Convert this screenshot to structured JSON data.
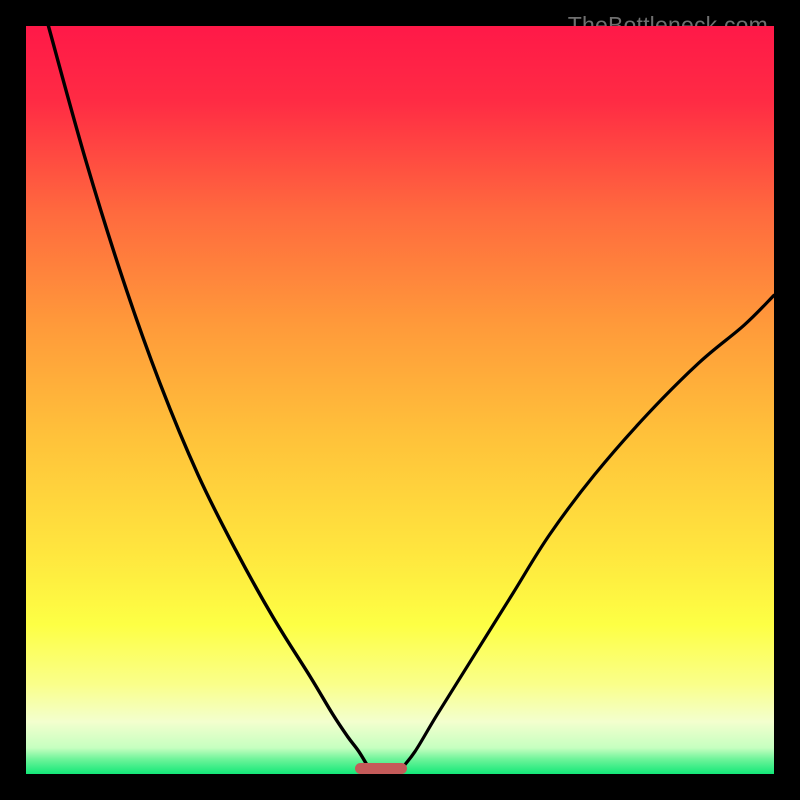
{
  "watermark": "TheBottleneck.com",
  "chart_data": {
    "type": "line",
    "title": "",
    "xlabel": "",
    "ylabel": "",
    "xlim": [
      0,
      100
    ],
    "ylim": [
      0,
      100
    ],
    "grid": false,
    "legend": false,
    "axes_visible": false,
    "background_gradient": [
      "#ff1948",
      "#ff8a3a",
      "#ffd63b",
      "#fcff46",
      "#f6ffcc",
      "#15e87a"
    ],
    "series": [
      {
        "name": "left-branch",
        "x": [
          3,
          8,
          13,
          18,
          23,
          28,
          33,
          38,
          41,
          43,
          44.5,
          46
        ],
        "y": [
          100,
          82,
          66,
          52,
          40,
          30,
          21,
          13,
          8,
          5,
          3,
          0.5
        ]
      },
      {
        "name": "right-branch",
        "x": [
          50,
          52,
          55,
          60,
          65,
          70,
          76,
          83,
          90,
          96,
          100
        ],
        "y": [
          0.5,
          3,
          8,
          16,
          24,
          32,
          40,
          48,
          55,
          60,
          64
        ]
      }
    ],
    "marker": {
      "name": "optimal-zone",
      "x_start": 44,
      "x_end": 51,
      "y": 0,
      "color": "#c45a59"
    }
  }
}
